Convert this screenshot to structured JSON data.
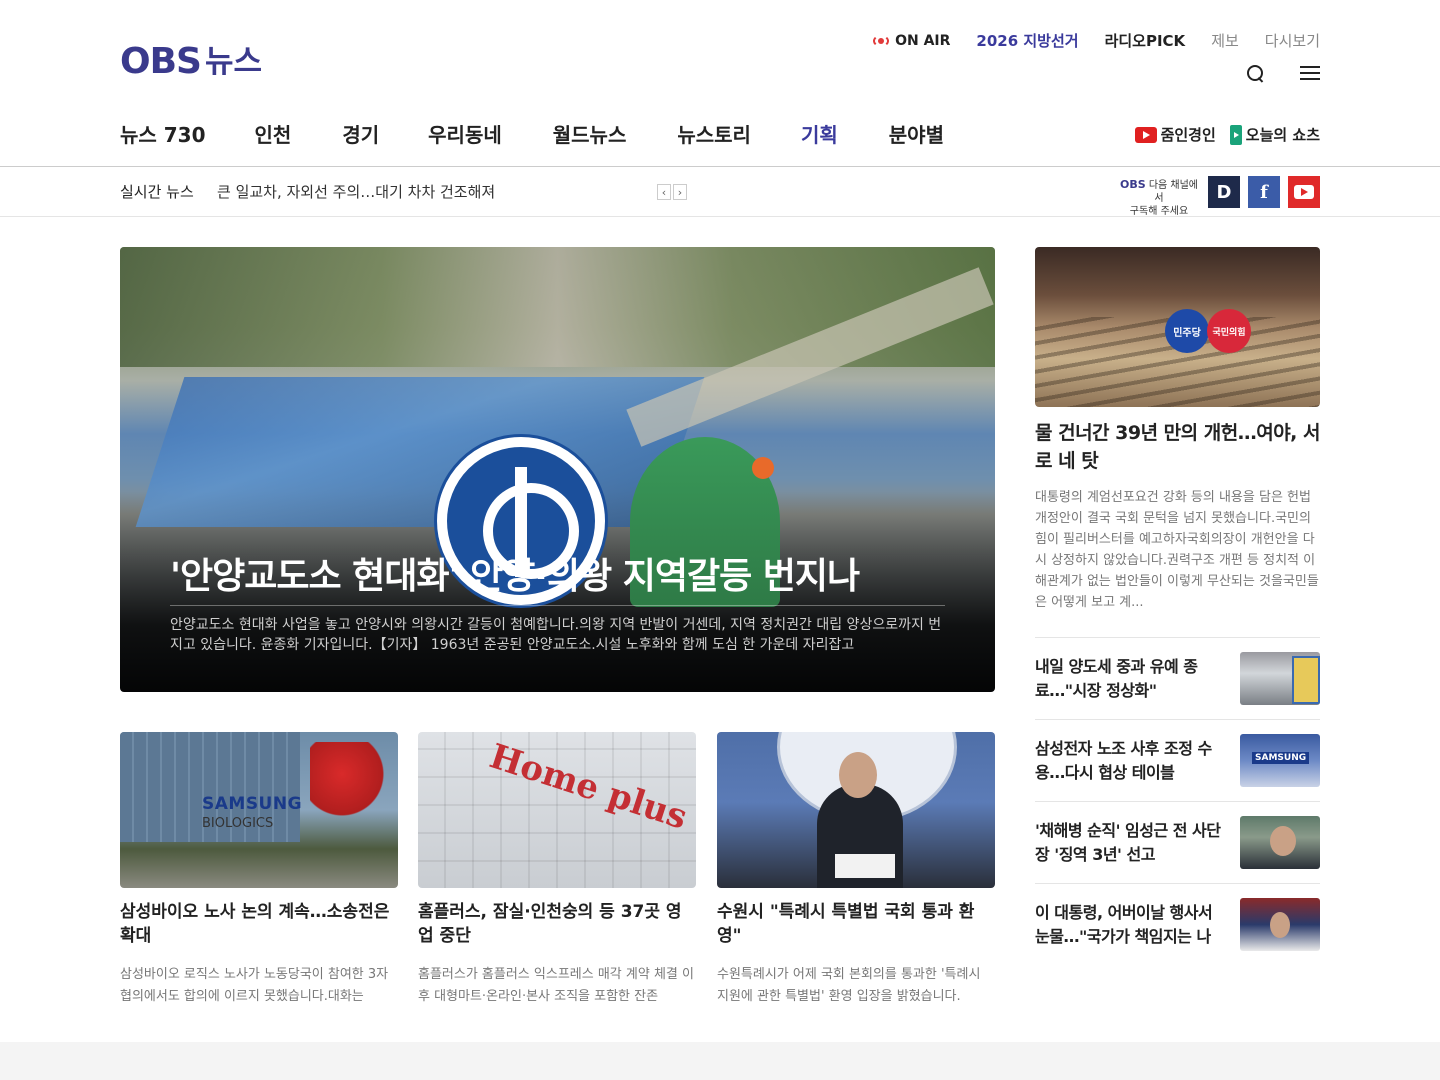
{
  "header": {
    "logo_obs": "OBS",
    "logo_news": "뉴스",
    "utility": {
      "onair": "ON AIR",
      "election": "2026 지방선거",
      "radio": "라디오PICK",
      "tip": "제보",
      "replay": "다시보기"
    },
    "icons": {
      "search": "search-icon",
      "menu": "menu-icon"
    },
    "nav": [
      {
        "label": "뉴스 730"
      },
      {
        "label": "인천"
      },
      {
        "label": "경기"
      },
      {
        "label": "우리동네"
      },
      {
        "label": "월드뉴스"
      },
      {
        "label": "뉴스토리"
      },
      {
        "label": "기획",
        "active": true
      },
      {
        "label": "분야별"
      }
    ],
    "promo": [
      {
        "label": "줌인경인",
        "icon": "youtube-icon"
      },
      {
        "label": "오늘의 쇼츠",
        "icon": "phone-icon"
      }
    ]
  },
  "ticker": {
    "label": "실시간 뉴스",
    "text": "큰 일교차, 자외선 주의…대기 차차 건조해져",
    "prev": "‹",
    "next": "›",
    "subscribe_brand": "OBS",
    "subscribe_line1": "다음 채널에서",
    "subscribe_line2": "구독해 주세요",
    "social": {
      "daum": "D",
      "facebook": "f"
    }
  },
  "hero": {
    "title": "'안양교도소 현대화' 안양·의왕 지역갈등 번지나",
    "desc": "안양교도소 현대화 사업을 놓고 안양시와 의왕시간 갈등이 첨예합니다.의왕 지역 반발이 거센데, 지역 정치권간 대립 양상으로까지 번지고 있습니다. 윤종화 기자입니다.【기자】 1963년 준공된 안양교도소.시설 노후화와 함께 도심 한 가운데 자리잡고"
  },
  "cards": [
    {
      "thumb_text1": "SAMSUNG",
      "thumb_text2": "BIOLOGICS",
      "title": "삼성바이오 노사 논의 계속…소송전은 확대",
      "desc": "삼성바이오 로직스 노사가 노동당국이 참여한 3자 협의에서도 합의에 이르지 못했습니다.대화는"
    },
    {
      "thumb_text1": "Home plus",
      "title": "홈플러스, 잠실·인천숭의 등 37곳 영업 중단",
      "desc": "홈플러스가 홈플러스 익스프레스 매각 계약 체결 이후 대형마트·온라인·본사 조직을 포함한 잔존"
    },
    {
      "title": "수원시 \"특례시 특별법 국회 통과 환영\"",
      "desc": "수원특례시가 어제 국회 본회의를 통과한 '특례시 지원에 관한 특별법' 환영 입장을 밝혔습니다."
    }
  ],
  "side_top": {
    "badge1": "민주당",
    "badge2": "국민의힘",
    "title": "물 건너간 39년 만의 개헌…여야, 서로 네 탓",
    "desc": "대통령의 계엄선포요건 강화 등의 내용을 담은 헌법 개정안이 결국 국회 문턱을 넘지 못했습니다.국민의힘이 필리버스터를 예고하자국회의장이 개헌안을 다시 상정하지 않았습니다.권력구조 개편 등 정치적 이해관계가 없는 법안들이 이렇게 무산되는 것을국민들은 어떻게 보고 계..."
  },
  "side_list": [
    {
      "title": "내일 양도세 중과 유예 종료…\"시장 정상화\""
    },
    {
      "title": "삼성전자 노조 사후 조정 수용…다시 협상 테이블"
    },
    {
      "title": "'채해병 순직' 임성근 전 사단장 '징역 3년' 선고"
    },
    {
      "title": "이 대통령, 어버이날 행사서 눈물…\"국가가 책임지는 나"
    }
  ],
  "colors": {
    "brand": "#3a3a8c",
    "active_nav": "#3a3a9c",
    "onair_red": "#e23a3a",
    "youtube_red": "#e02a2a",
    "facebook_blue": "#3b5ca8",
    "daum_navy": "#1e2a4a"
  }
}
